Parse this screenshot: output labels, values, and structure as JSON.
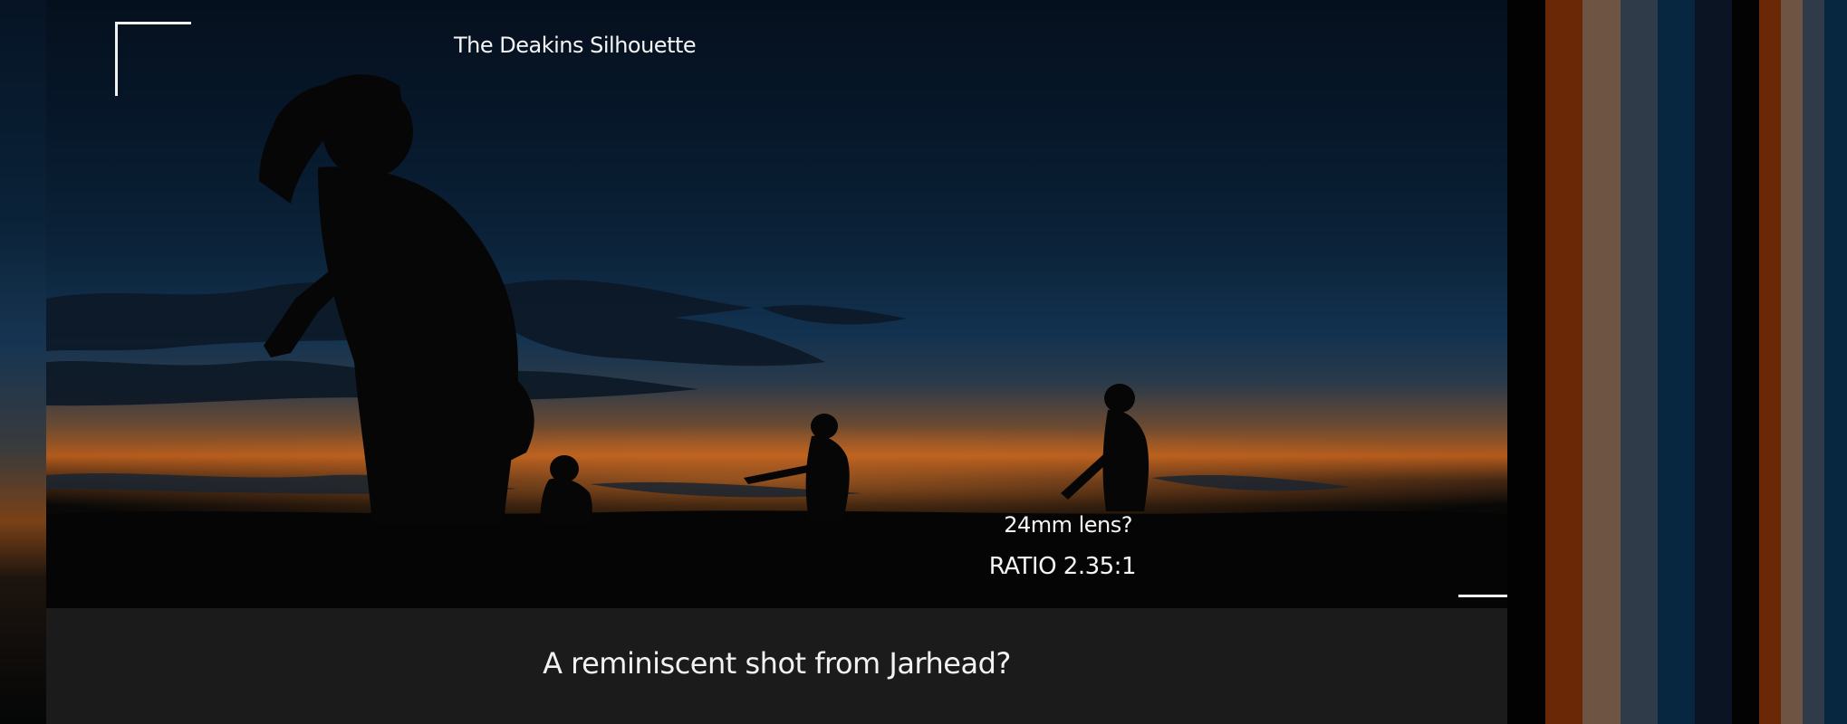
{
  "frame": {
    "title": "The Deakins Silhouette",
    "lens_note": "24mm lens?",
    "ratio_label": "RATIO 2.35:1"
  },
  "caption": {
    "text": "A reminiscent shot from Jarhead?"
  },
  "palette": {
    "colors": [
      {
        "name": "black",
        "hex": "#020202"
      },
      {
        "name": "burnt-orange",
        "hex": "#6a2806"
      },
      {
        "name": "tan-brown",
        "hex": "#6e5543"
      },
      {
        "name": "slate-blue",
        "hex": "#2f3b48"
      },
      {
        "name": "deep-navy",
        "hex": "#072640"
      },
      {
        "name": "midnight",
        "hex": "#0b1422"
      },
      {
        "name": "black",
        "hex": "#030303"
      },
      {
        "name": "burnt-orange",
        "hex": "#6a2806"
      },
      {
        "name": "tan-brown",
        "hex": "#6e5543"
      },
      {
        "name": "slate-blue",
        "hex": "#2f3b48"
      },
      {
        "name": "deep-navy",
        "hex": "#072640"
      }
    ]
  }
}
